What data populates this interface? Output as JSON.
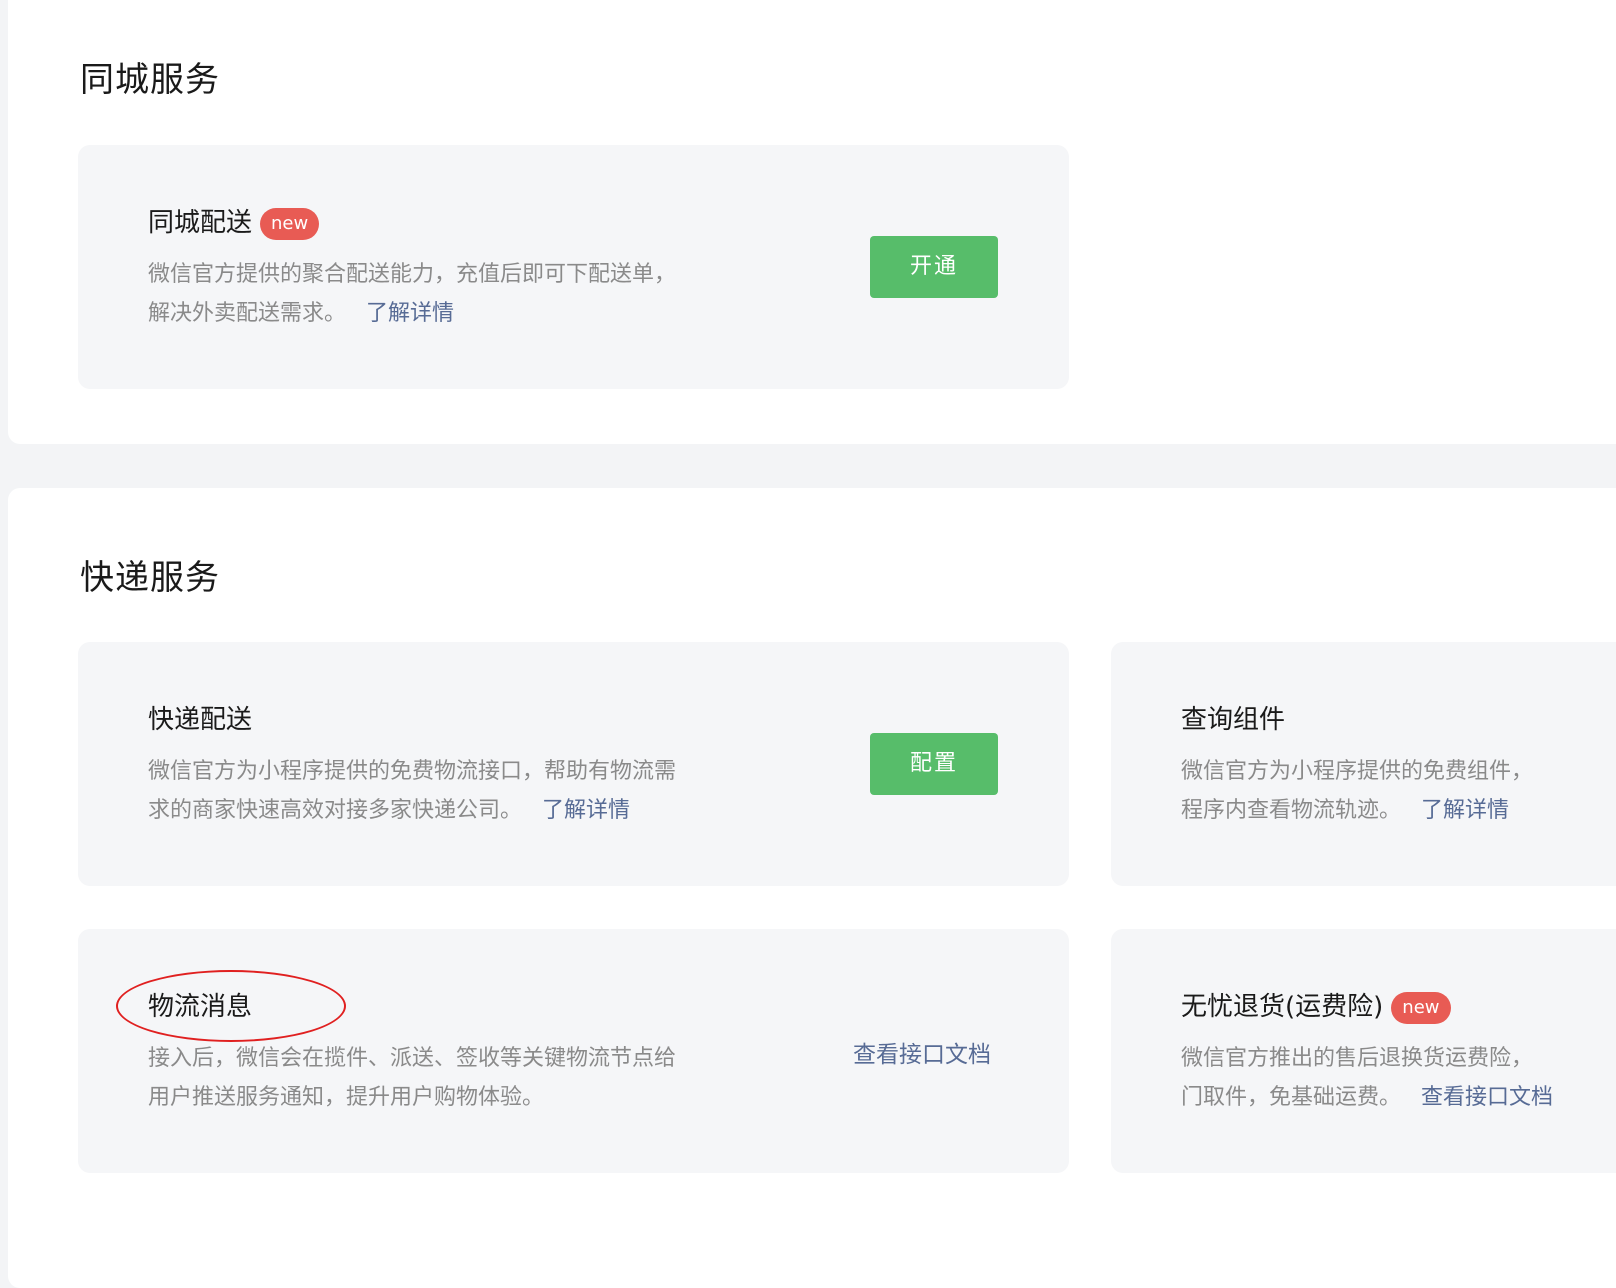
{
  "city_service": {
    "title": "同城服务",
    "cards": [
      {
        "title": "同城配送",
        "badge": "new",
        "desc_line1": "微信官方提供的聚合配送能力，充值后即可下配送单，",
        "desc_line2": "解决外卖配送需求。",
        "link": "了解详情",
        "button": "开通"
      }
    ]
  },
  "express_service": {
    "title": "快递服务",
    "cards": [
      {
        "title": "快递配送",
        "desc_line1": "微信官方为小程序提供的免费物流接口，帮助有物流需",
        "desc_line2": "求的商家快速高效对接多家快递公司。",
        "link": "了解详情",
        "button": "配置"
      },
      {
        "title": "查询组件",
        "desc_line1": "微信官方为小程序提供的免费组件，",
        "desc_line2": "程序内查看物流轨迹。",
        "link": "了解详情"
      },
      {
        "title": "物流消息",
        "desc_line1": "接入后，微信会在揽件、派送、签收等关键物流节点给",
        "desc_line2": "用户推送服务通知，提升用户购物体验。",
        "action_link": "查看接口文档"
      },
      {
        "title": "无忧退货(运费险)",
        "badge": "new",
        "desc_line1": "微信官方推出的售后退换货运费险，",
        "desc_line2": "门取件，免基础运费。",
        "link": "查看接口文档"
      }
    ]
  },
  "colors": {
    "accent_green": "#57bd6a",
    "link_blue": "#576b95",
    "badge_red": "#e85b54",
    "annotation_red": "#e02020"
  }
}
